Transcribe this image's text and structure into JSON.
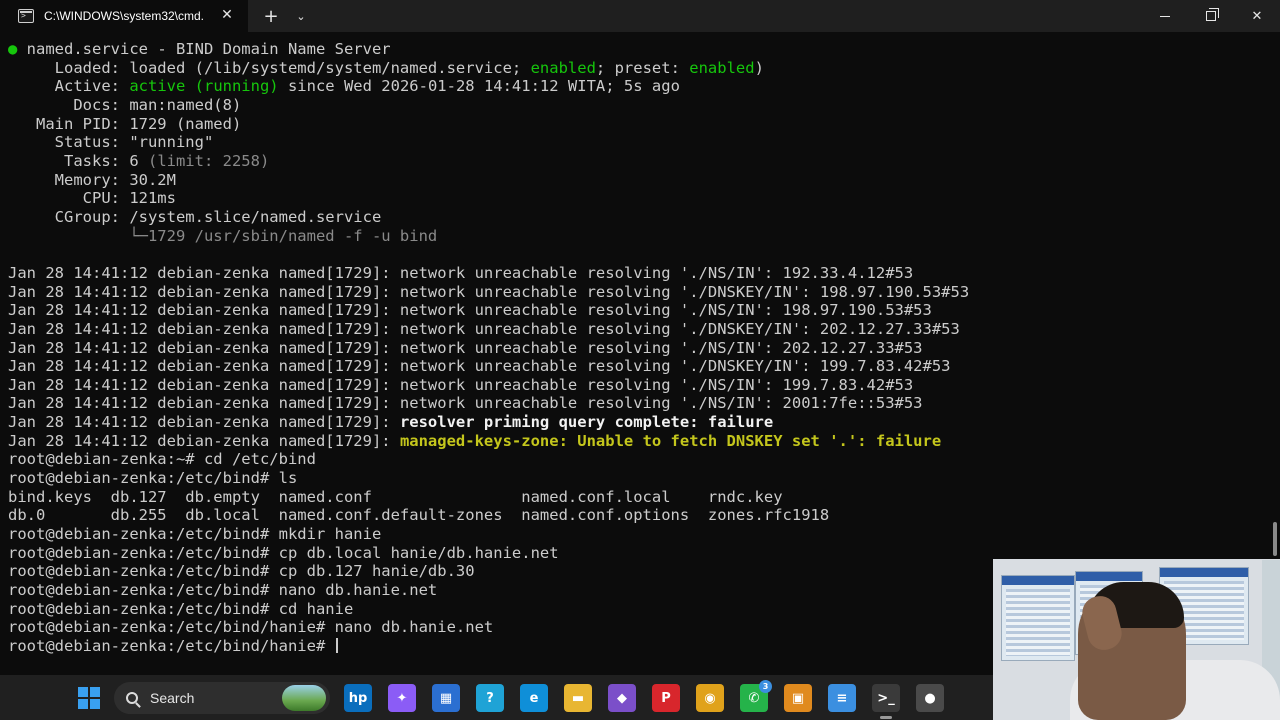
{
  "window": {
    "tab_title": "C:\\WINDOWS\\system32\\cmd.",
    "tab_close": "✕",
    "new_tab": "+",
    "dropdown": "⌄",
    "minimize": "",
    "close": "✕"
  },
  "terminal": {
    "lines": [
      [
        {
          "t": "● ",
          "c": "green"
        },
        {
          "t": "named.service - BIND Domain Name Server"
        }
      ],
      [
        {
          "t": "     Loaded: loaded (/lib/systemd/system/named.service; "
        },
        {
          "t": "enabled",
          "c": "green"
        },
        {
          "t": "; preset: "
        },
        {
          "t": "enabled",
          "c": "green"
        },
        {
          "t": ")"
        }
      ],
      [
        {
          "t": "     Active: "
        },
        {
          "t": "active (running)",
          "c": "green"
        },
        {
          "t": " since Wed 2026-01-28 14:41:12 WITA; 5s ago"
        }
      ],
      [
        {
          "t": "       Docs: man:named(8)"
        }
      ],
      [
        {
          "t": "   Main PID: 1729 (named)"
        }
      ],
      [
        {
          "t": "     Status: \"running\""
        }
      ],
      [
        {
          "t": "      Tasks: 6 "
        },
        {
          "t": "(limit: 2258)",
          "c": "gray"
        }
      ],
      [
        {
          "t": "     Memory: 30.2M"
        }
      ],
      [
        {
          "t": "        CPU: 121ms"
        }
      ],
      [
        {
          "t": "     CGroup: /system.slice/named.service"
        }
      ],
      [
        {
          "t": "             └─1729 /usr/sbin/named -f -u bind",
          "c": "gray"
        }
      ],
      [
        {
          "t": ""
        }
      ],
      [
        {
          "t": "Jan 28 14:41:12 debian-zenka named[1729]: network unreachable resolving './NS/IN': 192.33.4.12#53"
        }
      ],
      [
        {
          "t": "Jan 28 14:41:12 debian-zenka named[1729]: network unreachable resolving './DNSKEY/IN': 198.97.190.53#53"
        }
      ],
      [
        {
          "t": "Jan 28 14:41:12 debian-zenka named[1729]: network unreachable resolving './NS/IN': 198.97.190.53#53"
        }
      ],
      [
        {
          "t": "Jan 28 14:41:12 debian-zenka named[1729]: network unreachable resolving './DNSKEY/IN': 202.12.27.33#53"
        }
      ],
      [
        {
          "t": "Jan 28 14:41:12 debian-zenka named[1729]: network unreachable resolving './NS/IN': 202.12.27.33#53"
        }
      ],
      [
        {
          "t": "Jan 28 14:41:12 debian-zenka named[1729]: network unreachable resolving './DNSKEY/IN': 199.7.83.42#53"
        }
      ],
      [
        {
          "t": "Jan 28 14:41:12 debian-zenka named[1729]: network unreachable resolving './NS/IN': 199.7.83.42#53"
        }
      ],
      [
        {
          "t": "Jan 28 14:41:12 debian-zenka named[1729]: network unreachable resolving './NS/IN': 2001:7fe::53#53"
        }
      ],
      [
        {
          "t": "Jan 28 14:41:12 debian-zenka named[1729]: "
        },
        {
          "t": "resolver priming query complete: failure",
          "c": "bright"
        }
      ],
      [
        {
          "t": "Jan 28 14:41:12 debian-zenka named[1729]: "
        },
        {
          "t": "managed-keys-zone: Unable to fetch DNSKEY set '.': failure",
          "c": "yellow"
        }
      ],
      [
        {
          "t": "root@debian-zenka:~# cd /etc/bind"
        }
      ],
      [
        {
          "t": "root@debian-zenka:/etc/bind# ls"
        }
      ],
      [
        {
          "t": "bind.keys  db.127  db.empty  named.conf                named.conf.local    rndc.key"
        }
      ],
      [
        {
          "t": "db.0       db.255  db.local  named.conf.default-zones  named.conf.options  zones.rfc1918"
        }
      ],
      [
        {
          "t": "root@debian-zenka:/etc/bind# mkdir hanie"
        }
      ],
      [
        {
          "t": "root@debian-zenka:/etc/bind# cp db.local hanie/db.hanie.net"
        }
      ],
      [
        {
          "t": "root@debian-zenka:/etc/bind# cp db.127 hanie/db.30"
        }
      ],
      [
        {
          "t": "root@debian-zenka:/etc/bind# nano db.hanie.net"
        }
      ],
      [
        {
          "t": "root@debian-zenka:/etc/bind# cd hanie"
        }
      ],
      [
        {
          "t": "root@debian-zenka:/etc/bind/hanie# nano db.hanie.net"
        }
      ],
      [
        {
          "t": "root@debian-zenka:/etc/bind/hanie# "
        }
      ]
    ]
  },
  "taskbar": {
    "search_label": "Search",
    "icons": [
      {
        "name": "hp-icon",
        "glyph": "hp",
        "bg": "#0a6ebd"
      },
      {
        "name": "copilot-icon",
        "glyph": "✦",
        "bg": "#8b5cf6"
      },
      {
        "name": "microsoft-store-icon",
        "glyph": "▦",
        "bg": "#2b6fd1"
      },
      {
        "name": "get-help-icon",
        "glyph": "?",
        "bg": "#1fa3d6",
        "badge": ""
      },
      {
        "name": "edge-icon",
        "glyph": "e",
        "bg": "#0f8fd8"
      },
      {
        "name": "file-explorer-icon",
        "glyph": "▬",
        "bg": "#e8b632"
      },
      {
        "name": "visual-studio-icon",
        "glyph": "◆",
        "bg": "#7b4fc9"
      },
      {
        "name": "pinterest-icon",
        "glyph": "P",
        "bg": "#d8262c"
      },
      {
        "name": "chrome-icon",
        "glyph": "◉",
        "bg": "#e0a21b"
      },
      {
        "name": "whatsapp-icon",
        "glyph": "✆",
        "bg": "#25b34a",
        "badge": "3"
      },
      {
        "name": "remote-desktop-icon",
        "glyph": "▣",
        "bg": "#e08a1e"
      },
      {
        "name": "notepad-icon",
        "glyph": "≡",
        "bg": "#3b8fe0"
      },
      {
        "name": "terminal-icon",
        "glyph": ">_",
        "bg": "#3a3a3a",
        "active": "true"
      },
      {
        "name": "obs-icon",
        "glyph": "●",
        "bg": "#4a4a4a"
      }
    ]
  }
}
